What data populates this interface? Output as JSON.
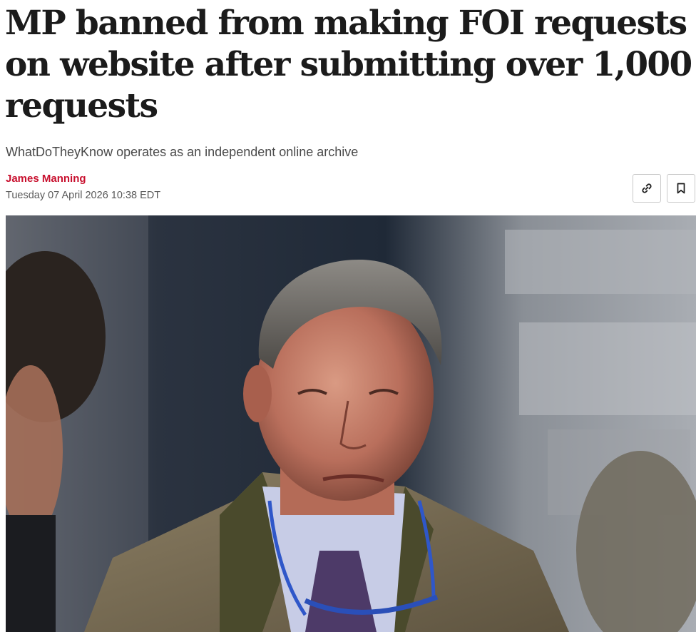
{
  "article": {
    "headline": "MP banned from making FOI requests on website after submitting over 1,000 requests",
    "standfirst": "WhatDoTheyKnow operates as an independent online archive",
    "author": "James Manning",
    "date": "Tuesday 07 April 2026 10:38 EDT"
  },
  "actions": {
    "copy_link_icon": "link-icon",
    "bookmark_icon": "bookmark-icon"
  },
  "colors": {
    "author": "#c8102e",
    "headline": "#1b1b1b",
    "standfirst": "#4a4a4a",
    "meta": "#595959"
  }
}
